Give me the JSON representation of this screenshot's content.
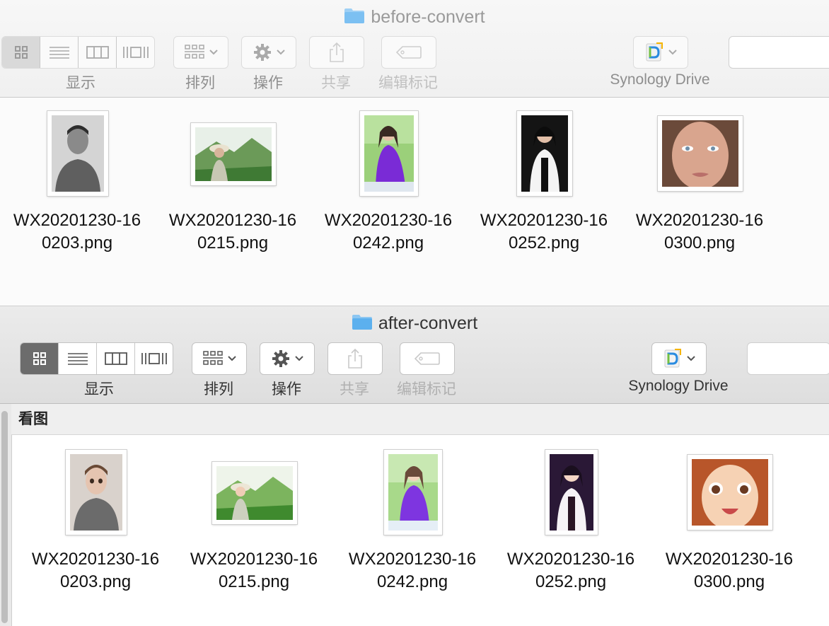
{
  "top_window": {
    "title": "before-convert",
    "toolbar": {
      "view_label": "显示",
      "arrange_label": "排列",
      "action_label": "操作",
      "share_label": "共享",
      "tags_label": "编辑标记",
      "synology_label": "Synology Drive"
    },
    "files": [
      {
        "name_line1": "WX20201230-16",
        "name_line2": "0203.png"
      },
      {
        "name_line1": "WX20201230-16",
        "name_line2": "0215.png"
      },
      {
        "name_line1": "WX20201230-16",
        "name_line2": "0242.png"
      },
      {
        "name_line1": "WX20201230-16",
        "name_line2": "0252.png"
      },
      {
        "name_line1": "WX20201230-16",
        "name_line2": "0300.png"
      }
    ]
  },
  "bottom_window": {
    "title": "after-convert",
    "toolbar": {
      "view_label": "显示",
      "arrange_label": "排列",
      "action_label": "操作",
      "share_label": "共享",
      "tags_label": "编辑标记",
      "synology_label": "Synology Drive"
    },
    "path_label": "看图",
    "files": [
      {
        "name_line1": "WX20201230-16",
        "name_line2": "0203.png"
      },
      {
        "name_line1": "WX20201230-16",
        "name_line2": "0215.png"
      },
      {
        "name_line1": "WX20201230-16",
        "name_line2": "0242.png"
      },
      {
        "name_line1": "WX20201230-16",
        "name_line2": "0252.png"
      },
      {
        "name_line1": "WX20201230-16",
        "name_line2": "0300.png"
      }
    ]
  },
  "icons": {
    "folder": "folder-icon",
    "grid_view": "icon-view-icon",
    "list_view": "list-view-icon",
    "column_view": "column-view-icon",
    "gallery_view": "cover-flow-icon",
    "arrange": "group-arrange-icon",
    "action": "gear-icon",
    "share": "share-icon",
    "tags": "tag-icon",
    "synology": "synology-drive-icon"
  },
  "colors": {
    "folder_blue": "#6cb8f0",
    "selected_segment_dark": "#6c6c6c",
    "synology_green": "#74c043",
    "synology_blue": "#2a8be0"
  }
}
